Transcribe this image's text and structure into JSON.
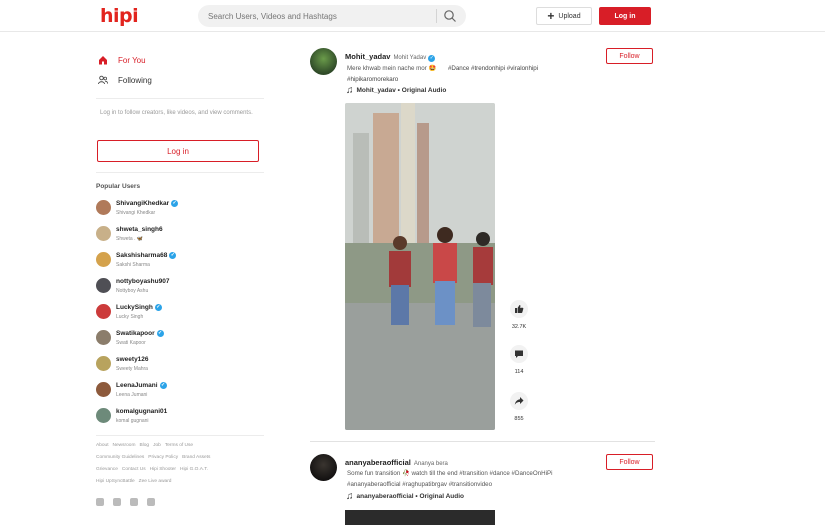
{
  "app": {
    "logo": "hipi"
  },
  "header": {
    "search_placeholder": "Search Users, Videos and Hashtags",
    "upload_label": "Upload",
    "login_label": "Log in"
  },
  "sidebar": {
    "nav": [
      {
        "label": "For You",
        "icon": "home-icon",
        "active": true
      },
      {
        "label": "Following",
        "icon": "people-icon",
        "active": false
      }
    ],
    "login_note": "Log in to follow creators, like videos, and view comments.",
    "login_label": "Log in",
    "popular_title": "Popular Users",
    "users": [
      {
        "handle": "ShivangiKhedkar",
        "name": "Shivangi Khedkar",
        "verified": true,
        "color": "#b07a5a"
      },
      {
        "handle": "shweta_singh6",
        "name": "Shweta . 🦋",
        "verified": false,
        "color": "#c8b089"
      },
      {
        "handle": "Sakshisharma68",
        "name": "Sakshi Sharma",
        "verified": true,
        "color": "#d4a24c"
      },
      {
        "handle": "nottyboyashu907",
        "name": "Nottyboy Ashu",
        "verified": false,
        "color": "#4f4f55"
      },
      {
        "handle": "LuckySingh",
        "name": "Lucky Singh",
        "verified": true,
        "color": "#cc3b3b"
      },
      {
        "handle": "Swatikapoor",
        "name": "Swati Kapoor",
        "verified": true,
        "color": "#8b7d6b"
      },
      {
        "handle": "sweety126",
        "name": "Sweety Mahra",
        "verified": false,
        "color": "#b8a35e"
      },
      {
        "handle": "LeenaJumani",
        "name": "Leena Jumani",
        "verified": true,
        "color": "#8d5a3c"
      },
      {
        "handle": "komalgugnani01",
        "name": "komal gugnani",
        "verified": false,
        "color": "#6d8a7a"
      }
    ],
    "footer_rows": [
      [
        "About",
        "Newsroom",
        "Blog",
        "Job",
        "Terms of Use"
      ],
      [
        "Community Guidelines",
        "Privacy Policy",
        "Brand Assets"
      ],
      [
        "Grievance",
        "Contact Us",
        "Hipi Shooter",
        "Hipi G.O.A.T."
      ],
      [
        "Hipi UpSyncBattle",
        "Zee Live award"
      ]
    ]
  },
  "feed": {
    "posts": [
      {
        "handle": "Mohit_yadav",
        "display_name": "Mohit Yadav",
        "verified": true,
        "caption": "Mere khwab mein nache mor 🤩",
        "tags": "#Dance #trendonhipi #viralonhipi #hipikaromorekaro",
        "audio": "Mohit_yadav • Original Audio",
        "follow_label": "Follow",
        "likes": "32.7K",
        "comments": "114",
        "shares": "855"
      },
      {
        "handle": "ananyaberaofficial",
        "display_name": "Ananya bera",
        "verified": false,
        "caption": "Some fun transition 🥀 watch till the end #transition #dance #DanceOnHiPi #ananyaberaofficial #raghupatibrgav #transitionvideo",
        "audio": "ananyaberaofficial • Original Audio",
        "follow_label": "Follow"
      }
    ]
  },
  "colors": {
    "brand": "#d81e27",
    "verified": "#2ba3e8"
  }
}
